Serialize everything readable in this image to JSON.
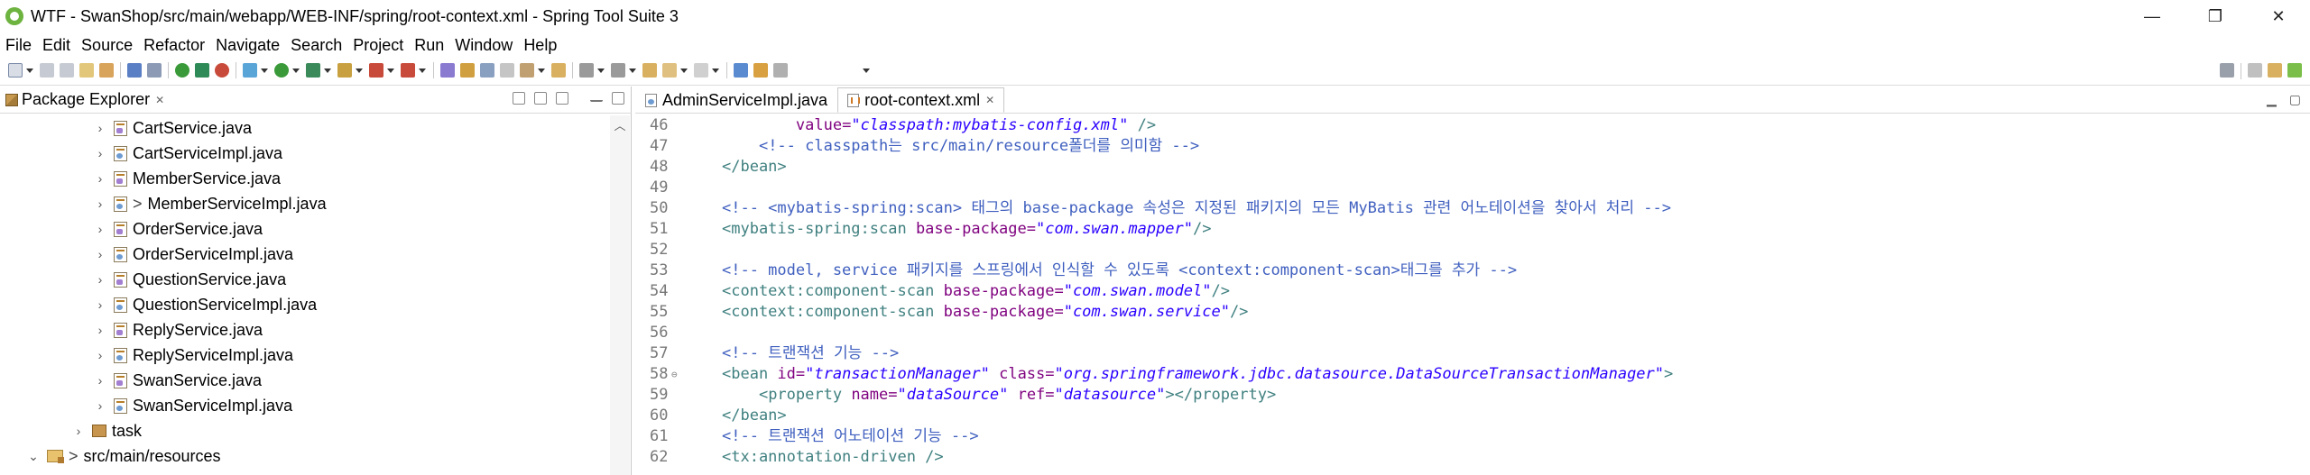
{
  "window": {
    "title": "WTF - SwanShop/src/main/webapp/WEB-INF/spring/root-context.xml - Spring Tool Suite 3",
    "controls": [
      "—",
      "❐",
      "✕"
    ]
  },
  "menu": [
    "File",
    "Edit",
    "Source",
    "Refactor",
    "Navigate",
    "Search",
    "Project",
    "Run",
    "Window",
    "Help"
  ],
  "package_explorer": {
    "title": "Package Explorer",
    "close": "✕",
    "items": [
      {
        "label": "CartService.java",
        "kind": "interface",
        "dirty": ""
      },
      {
        "label": "CartServiceImpl.java",
        "kind": "class",
        "dirty": ""
      },
      {
        "label": "MemberService.java",
        "kind": "interface",
        "dirty": ""
      },
      {
        "label": "MemberServiceImpl.java",
        "kind": "class",
        "dirty": ">"
      },
      {
        "label": "OrderService.java",
        "kind": "interface",
        "dirty": ""
      },
      {
        "label": "OrderServiceImpl.java",
        "kind": "class",
        "dirty": ""
      },
      {
        "label": "QuestionService.java",
        "kind": "interface",
        "dirty": ""
      },
      {
        "label": "QuestionServiceImpl.java",
        "kind": "class",
        "dirty": ""
      },
      {
        "label": "ReplyService.java",
        "kind": "interface",
        "dirty": ""
      },
      {
        "label": "ReplyServiceImpl.java",
        "kind": "class",
        "dirty": ""
      },
      {
        "label": "SwanService.java",
        "kind": "interface",
        "dirty": ""
      },
      {
        "label": "SwanServiceImpl.java",
        "kind": "class",
        "dirty": ""
      }
    ],
    "task_folder": "task",
    "resources_folder": "src/main/resources",
    "resources_prefix": ">"
  },
  "editor": {
    "tabs": [
      {
        "label": "AdminServiceImpl.java",
        "active": false
      },
      {
        "label": "root-context.xml",
        "active": true,
        "close": "✕"
      }
    ],
    "lines": [
      {
        "n": "46",
        "indent": "        ",
        "parts": [
          [
            "attr",
            "value="
          ],
          [
            "val",
            "\"classpath:mybatis-config.xml\""
          ],
          [
            "tag",
            " />"
          ]
        ]
      },
      {
        "n": "47",
        "indent": "    ",
        "parts": [
          [
            "com",
            "<!-- classpath는 src/main/resource폴더를 의미함 -->"
          ]
        ]
      },
      {
        "n": "48",
        "indent": "",
        "parts": [
          [
            "tag",
            "</bean>"
          ]
        ]
      },
      {
        "n": "49",
        "indent": "",
        "parts": []
      },
      {
        "n": "50",
        "indent": "",
        "parts": [
          [
            "com",
            "<!-- <mybatis-spring:scan> 태그의 base-package 속성은 지정된 패키지의 모든 MyBatis 관련 어노테이션을 찾아서 처리 -->"
          ]
        ]
      },
      {
        "n": "51",
        "indent": "",
        "parts": [
          [
            "tag",
            "<mybatis-spring:scan "
          ],
          [
            "attr",
            "base-package="
          ],
          [
            "val",
            "\"com.swan.mapper\""
          ],
          [
            "tag",
            "/>"
          ]
        ]
      },
      {
        "n": "52",
        "indent": "",
        "parts": []
      },
      {
        "n": "53",
        "indent": "",
        "parts": [
          [
            "com",
            "<!-- model, service 패키지를 스프링에서 인식할 수 있도록 <context:component-scan>태그를 추가 -->"
          ]
        ]
      },
      {
        "n": "54",
        "indent": "",
        "parts": [
          [
            "tag",
            "<context:component-scan "
          ],
          [
            "attr",
            "base-package="
          ],
          [
            "val",
            "\"com.swan.model\""
          ],
          [
            "tag",
            "/>"
          ]
        ]
      },
      {
        "n": "55",
        "indent": "",
        "parts": [
          [
            "tag",
            "<context:component-scan "
          ],
          [
            "attr",
            "base-package="
          ],
          [
            "val",
            "\"com.swan.service\""
          ],
          [
            "tag",
            "/>"
          ]
        ]
      },
      {
        "n": "56",
        "indent": "",
        "parts": []
      },
      {
        "n": "57",
        "indent": "",
        "parts": [
          [
            "com",
            "<!-- 트랜잭션 기능 -->"
          ]
        ]
      },
      {
        "n": "58",
        "indent": "",
        "fold": "⊖",
        "parts": [
          [
            "tag",
            "<bean "
          ],
          [
            "attr",
            "id="
          ],
          [
            "val",
            "\"transactionManager\""
          ],
          [
            "tag",
            " "
          ],
          [
            "attr",
            "class="
          ],
          [
            "val",
            "\"org.springframework.jdbc.datasource.DataSourceTransactionManager\""
          ],
          [
            "tag",
            ">"
          ]
        ]
      },
      {
        "n": "59",
        "indent": "    ",
        "parts": [
          [
            "tag",
            "<property "
          ],
          [
            "attr",
            "name="
          ],
          [
            "val",
            "\"dataSource\""
          ],
          [
            "tag",
            " "
          ],
          [
            "attr",
            "ref="
          ],
          [
            "val",
            "\"datasource\""
          ],
          [
            "tag",
            "></property>"
          ]
        ]
      },
      {
        "n": "60",
        "indent": "",
        "parts": [
          [
            "tag",
            "</bean>"
          ]
        ]
      },
      {
        "n": "61",
        "indent": "",
        "parts": [
          [
            "com",
            "<!-- 트랜잭션 어노테이션 기능 -->"
          ]
        ]
      },
      {
        "n": "62",
        "indent": "",
        "parts": [
          [
            "tag",
            "<tx:annotation-driven />"
          ]
        ]
      }
    ]
  },
  "colors": {
    "tag": "#3f7f7f",
    "attr": "#7f007f",
    "value": "#2a00ff",
    "comment": "#3f5fbf"
  }
}
